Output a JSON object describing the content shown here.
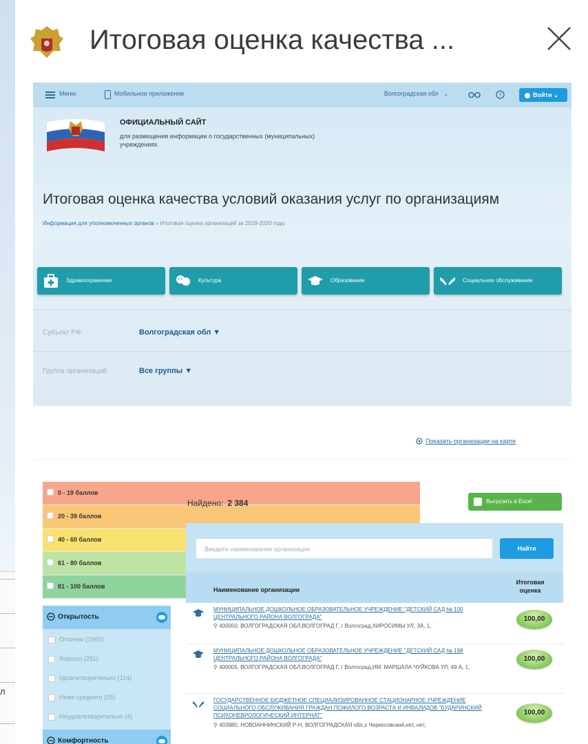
{
  "window": {
    "title": "Итоговая оценка качества ...",
    "close_icon": "close-icon"
  },
  "nav": {
    "menu": "Меню",
    "mobile": "Мобильное приложение",
    "region": "Волгоградская обл",
    "login": "Войти"
  },
  "site": {
    "title": "ОФИЦИАЛЬНЫЙ САЙТ",
    "subtitle": "для размещения информации о государственных (муниципальных) учреждениях"
  },
  "page": {
    "heading": "Итоговая оценка качества условий оказания услуг по организациям",
    "breadcrumb_1": "Информация для уполномоченных органов",
    "breadcrumb_sep": "»",
    "breadcrumb_2": "Итоговая оценка организаций за 2018-2020 годы"
  },
  "categories": [
    {
      "label": "Здравоохранение",
      "icon": "medkit-icon"
    },
    {
      "label": "Культура",
      "icon": "theater-masks-icon"
    },
    {
      "label": "Образование",
      "icon": "graduation-cap-icon"
    },
    {
      "label": "Социальное обслуживание",
      "icon": "hands-icon"
    }
  ],
  "filters": {
    "subject_label": "Субъект РФ:",
    "subject_value": "Волгоградская обл ▼",
    "group_label": "Группа организаций:",
    "group_value": "Все группы ▼"
  },
  "map_link": "Показать организации на карте",
  "legend": [
    {
      "label": "0 - 19 баллов",
      "color": "#f7a58d"
    },
    {
      "label": "20 - 39 баллов",
      "color": "#f9c775"
    },
    {
      "label": "40 - 60 баллов",
      "color": "#fae270"
    },
    {
      "label": "61 - 80 баллов",
      "color": "#bfe3a2"
    },
    {
      "label": "81 - 100 баллов",
      "color": "#8fd49c"
    }
  ],
  "openness": {
    "title": "Открытость",
    "options": [
      "Отлично (1960)",
      "Хорошо (281)",
      "Удовлетворительно (114)",
      "Ниже среднего (25)",
      "Неудовлетворительно (4)"
    ]
  },
  "comfort": {
    "title": "Комфортность"
  },
  "results": {
    "found_label": "Найдено:",
    "found_count": "2 384",
    "excel": "Выгрузить в Excel",
    "search_placeholder": "Введите наименование организации",
    "search_button": "Найти",
    "col_name": "Наименование организации",
    "col_score": "Итоговая оценка",
    "rows": [
      {
        "name": "МУНИЦИПАЛЬНОЕ ДОШКОЛЬНОЕ ОБРАЗОВАТЕЛЬНОЕ УЧРЕЖДЕНИЕ \"ДЕТСКИЙ САД № 100 ЦЕНТРАЛЬНОГО РАЙОНА ВОЛГОГРАДА\"",
        "address": "400050, ВОЛГОГРАДСКАЯ ОБЛ,ВОЛГОГРАД Г, г Волгоград,ХИРОСИМЫ УЛ, ЗА, 1,",
        "score": "100,00",
        "icon": "graduation-cap-icon"
      },
      {
        "name": "МУНИЦИПАЛЬНОЕ ДОШКОЛЬНОЕ ОБРАЗОВАТЕЛЬНОЕ УЧРЕЖДЕНИЕ \"ДЕТСКИЙ САД № 198 ЦЕНТРАЛЬНОГО РАЙОНА ВОЛГОГРАДА\"",
        "address": "400005, ВОЛГОГРАДСКАЯ ОБЛ,ВОЛГОГРАД Г, г Волгоград,ИМ. МАРШАЛА ЧУЙКОВА УЛ, 49 А, 1,",
        "score": "100,00",
        "icon": "graduation-cap-icon"
      },
      {
        "name": "ГОСУДАРСТВЕННОЕ БЮДЖЕТНОЕ СПЕЦИАЛИЗИРОВАННОЕ СТАЦИОНАРНОЕ УЧРЕЖДЕНИЕ СОЦИАЛЬНОГО ОБСЛУЖИВАНИЯ ГРАЖДАН ПОЖИЛОГО ВОЗРАСТА И ИНВАЛИДОВ \"БУДАРИНСКИЙ ПСИХОНЕВРОЛОГИЧЕСКИЙ ИНТЕРНАТ\"",
        "address": "403980, НОВОАННИНСКИЙ Р-Н, ВОЛГОГРАДСКАЯ обл,х Черкесовский,нет, нет,",
        "score": "100,00",
        "icon": "hands-icon"
      }
    ]
  },
  "left_edge_text": "л",
  "colors": {
    "accent": "#1e9be0",
    "category": "#1f9dab",
    "excel": "#58b44a",
    "panel": "#8ecdf1"
  }
}
